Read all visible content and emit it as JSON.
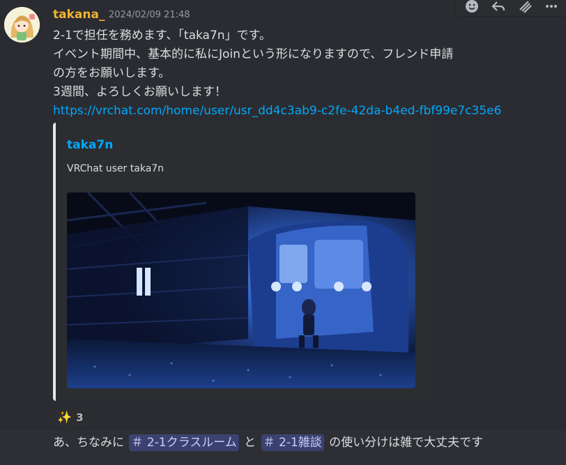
{
  "message": {
    "author": "takana_",
    "timestamp": "2024/02/09 21:48",
    "lines": [
      "2-1で担任を務めます、「taka7n」です。",
      "イベント期間中、基本的に私にJoinという形になりますので、フレンド申請",
      "の方をお願いします。",
      "3週間、よろしくお願いします！"
    ],
    "link": "https://vrchat.com/home/user/usr_dd4c3ab9-c2fe-42da-b4ed-fbf99e7c35e6",
    "embed": {
      "title": "taka7n",
      "description": "VRChat user taka7n",
      "image_icon": "vrchat-world-screenshot"
    },
    "reaction": {
      "emoji": "✨",
      "count": "3"
    }
  },
  "toolbar": {
    "icons": [
      "add-reaction-icon",
      "reply-icon",
      "forward-icon",
      "more-icon"
    ]
  },
  "next_message": {
    "prefix": "あ、ちなみに",
    "mention1": "＃ 2-1クラスルーム",
    "middle": "と",
    "mention2": "＃ 2-1雑談",
    "suffix": "の使い分けは雑で大丈夫です"
  },
  "colors": {
    "author": "#f0b232",
    "link": "#00a8fc",
    "mention_bg": "#3c4270",
    "background": "#2e2f34"
  }
}
